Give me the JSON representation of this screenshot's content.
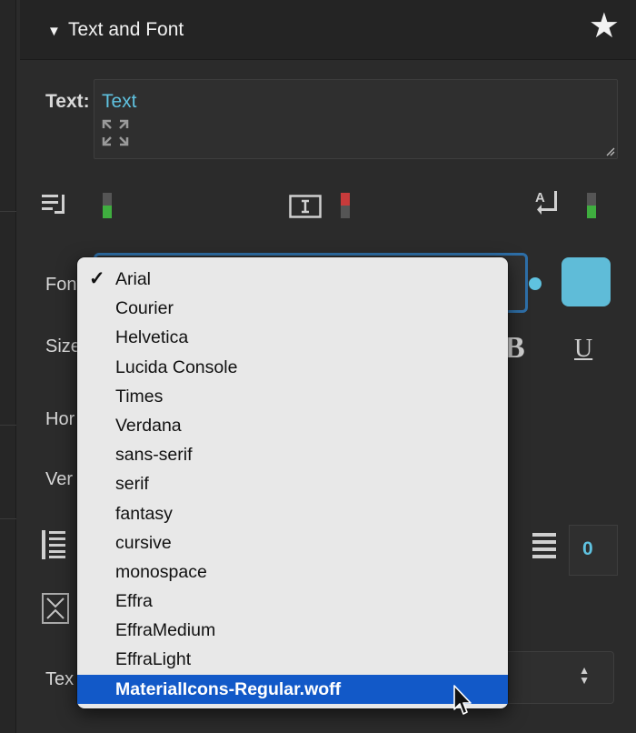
{
  "panel": {
    "section_title": "Text and Font",
    "text_label": "Text:",
    "text_value": "Text"
  },
  "labels": {
    "font": "Font",
    "size": "Size",
    "horizontal": "Hor",
    "vertical": "Ver",
    "text_style": "Tex"
  },
  "style_buttons": {
    "bold": "B",
    "underline": "U"
  },
  "line_height_value": "0",
  "colors": {
    "accent": "#5fc2e0",
    "swatch": "#5fbcd8",
    "selection": "#1259c8",
    "indicator_green": "#3fae3f",
    "indicator_red": "#c73b3b"
  },
  "font_dropdown": {
    "checked": "Arial",
    "highlighted": "MaterialIcons-Regular.woff",
    "options": [
      "Arial",
      "Courier",
      "Helvetica",
      "Lucida Console",
      "Times",
      "Verdana",
      "sans-serif",
      "serif",
      "fantasy",
      "cursive",
      "monospace",
      "Effra",
      "EffraMedium",
      "EffraLight",
      "MaterialIcons-Regular.woff"
    ]
  }
}
